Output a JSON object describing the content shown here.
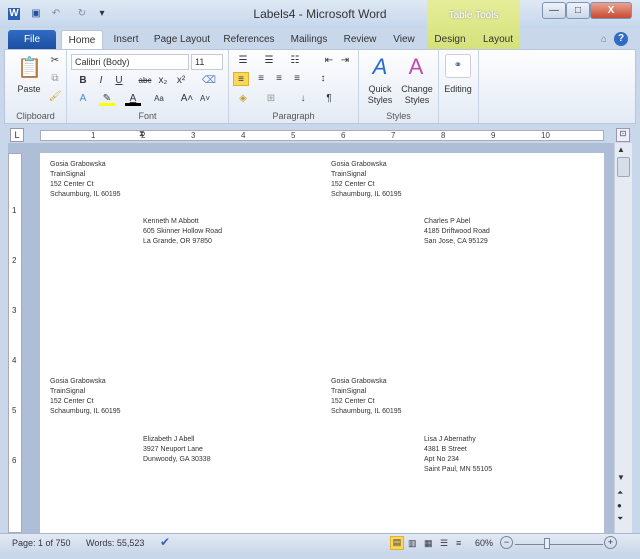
{
  "window": {
    "title": "Labels4 - Microsoft Word",
    "context_tab": "Table Tools",
    "minimize": "—",
    "maximize": "□",
    "close": "X"
  },
  "tabs": [
    "File",
    "Home",
    "Insert",
    "Page Layout",
    "References",
    "Mailings",
    "Review",
    "View",
    "Design",
    "Layout"
  ],
  "ribbon": {
    "clipboard": {
      "paste": "Paste",
      "label": "Clipboard"
    },
    "font": {
      "name": "Calibri (Body)",
      "size": "11",
      "label": "Font",
      "bold": "B",
      "italic": "I",
      "underline": "U",
      "strike": "abc",
      "sub": "x₂",
      "sup": "x²",
      "grow": "A˄",
      "shrink": "A˅",
      "case": "Aa"
    },
    "paragraph": {
      "label": "Paragraph",
      "pilcrow": "¶"
    },
    "styles": {
      "quick": "Quick Styles",
      "change": "Change Styles",
      "label": "Styles"
    },
    "editing": {
      "label": "Editing"
    }
  },
  "ruler": {
    "numbers": [
      "1",
      "2",
      "3",
      "4",
      "5",
      "6",
      "7",
      "8",
      "9",
      "10"
    ],
    "vnumbers": [
      "1",
      "2",
      "3",
      "4",
      "5",
      "6"
    ]
  },
  "labels": [
    {
      "sender": [
        "Gosia Grabowska",
        "TrainSignal",
        "152 Center Ct",
        "Schaumburg, IL 60195"
      ],
      "recipient": [
        "Kenneth M Abbott",
        "605 Skinner Hollow Road",
        "La Grande, OR 97850"
      ]
    },
    {
      "sender": [
        "Gosia Grabowska",
        "TrainSignal",
        "152 Center Ct",
        "Schaumburg, IL 60195"
      ],
      "recipient": [
        "Charles P Abel",
        "4185 Driftwood Road",
        "San Jose, CA 95129"
      ]
    },
    {
      "sender": [
        "Gosia Grabowska",
        "TrainSignal",
        "152 Center Ct",
        "Schaumburg, IL 60195"
      ],
      "recipient": [
        "Elizabeth J Abell",
        "3927 Neuport Lane",
        "Dunwoody, GA 30338"
      ]
    },
    {
      "sender": [
        "Gosia Grabowska",
        "TrainSignal",
        "152 Center Ct",
        "Schaumburg, IL 60195"
      ],
      "recipient": [
        "Lisa J Abernathy",
        "4381 B Street",
        "Apt No 234",
        "Saint Paul, MN 55105"
      ]
    }
  ],
  "status": {
    "page": "Page: 1 of 750",
    "words": "Words: 55,523",
    "zoom": "60%",
    "zoom_fraction": 0.35
  }
}
